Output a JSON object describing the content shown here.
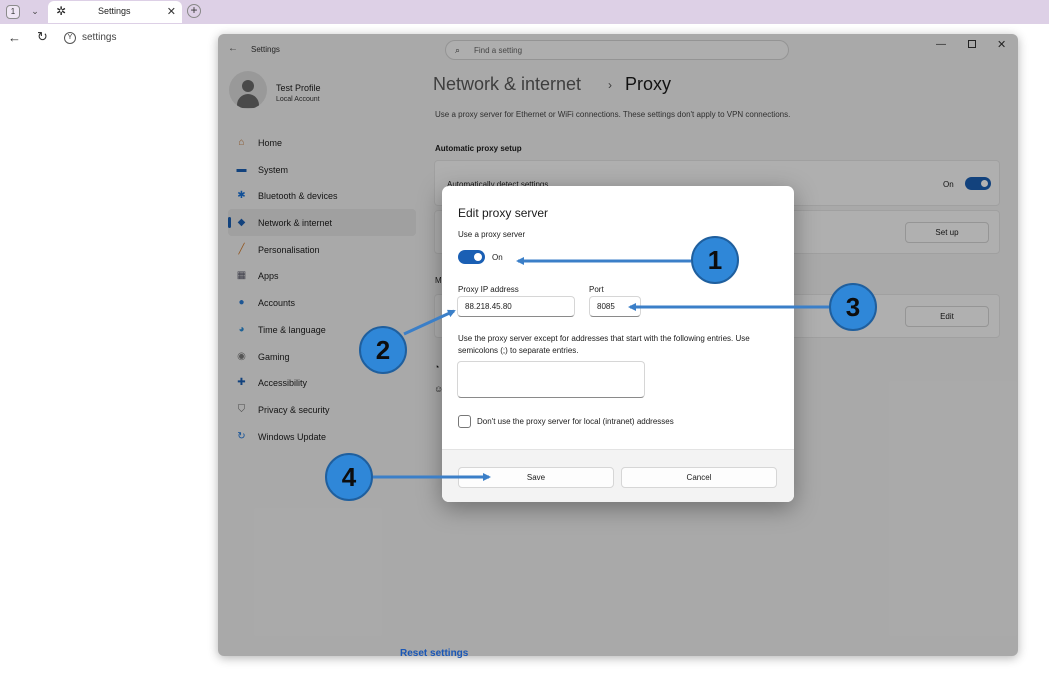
{
  "browser": {
    "tab_count": "1",
    "tab_title": "Settings",
    "address": "settings"
  },
  "window": {
    "app_title": "Settings",
    "search_placeholder": "Find a setting",
    "profile": {
      "name": "Test Profile",
      "type": "Local Account"
    },
    "nav": [
      {
        "label": "Home",
        "icon": "home-icon",
        "color": "#c47a3a"
      },
      {
        "label": "System",
        "icon": "monitor-icon",
        "color": "#1a5fb4"
      },
      {
        "label": "Bluetooth & devices",
        "icon": "bluetooth-icon",
        "color": "#1a73d9"
      },
      {
        "label": "Network & internet",
        "icon": "wifi-icon",
        "color": "#1a5fb4",
        "active": true
      },
      {
        "label": "Personalisation",
        "icon": "brush-icon",
        "color": "#d07a2c"
      },
      {
        "label": "Apps",
        "icon": "apps-icon",
        "color": "#5a5a6a"
      },
      {
        "label": "Accounts",
        "icon": "person-icon",
        "color": "#2a7bd4"
      },
      {
        "label": "Time & language",
        "icon": "globe-clock-icon",
        "color": "#2a8bd6"
      },
      {
        "label": "Gaming",
        "icon": "gamepad-icon",
        "color": "#7a7a7a"
      },
      {
        "label": "Accessibility",
        "icon": "accessibility-icon",
        "color": "#1a5fb4"
      },
      {
        "label": "Privacy & security",
        "icon": "shield-icon",
        "color": "#6a6a6a"
      },
      {
        "label": "Windows Update",
        "icon": "update-icon",
        "color": "#1a73d9"
      }
    ],
    "breadcrumb": {
      "parent": "Network & internet",
      "separator": "›",
      "current": "Proxy"
    },
    "description": "Use a proxy server for Ethernet or WiFi connections. These settings don't apply to VPN connections.",
    "auto_section_title": "Automatic proxy setup",
    "auto_detect_label": "Automatically detect settings",
    "auto_detect_state": "On",
    "setup_button": "Set up",
    "manual_section_letter": "M",
    "edit_button": "Edit",
    "reset_link": "Reset settings"
  },
  "dialog": {
    "title": "Edit proxy server",
    "use_proxy_label": "Use a proxy server",
    "use_proxy_state": "On",
    "ip_label": "Proxy IP address",
    "ip_value": "88.218.45.80",
    "port_label": "Port",
    "port_value": "8085",
    "exceptions_text": "Use the proxy server except for addresses that start with the following entries. Use semicolons (;) to separate entries.",
    "exceptions_value": "",
    "local_checkbox_label": "Don't use the proxy server for local (intranet) addresses",
    "local_checkbox_checked": false,
    "save_label": "Save",
    "cancel_label": "Cancel"
  },
  "annotations": [
    "1",
    "2",
    "3",
    "4"
  ],
  "colors": {
    "accent": "#1a5fb4",
    "callout": "#2f87d8",
    "arrow": "#3b7fc8"
  }
}
